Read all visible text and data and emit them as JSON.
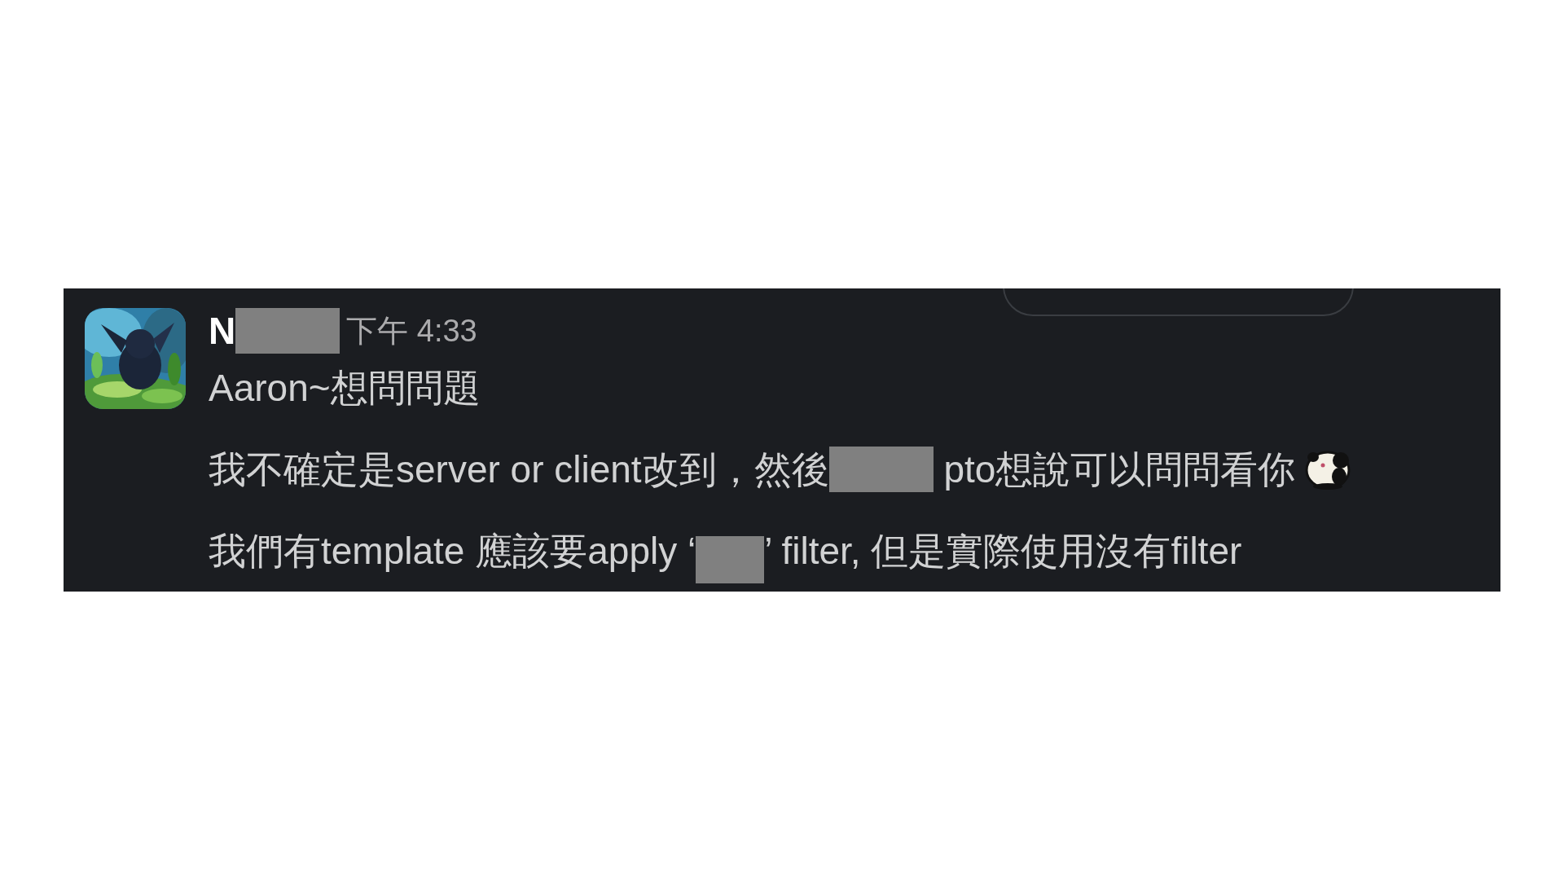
{
  "message": {
    "author": "N",
    "time": "下午 4:33",
    "lines": [
      {
        "segments": [
          {
            "kind": "text",
            "text": "Aaron~想問問題"
          }
        ]
      },
      {
        "segments": [
          {
            "kind": "text",
            "text": "我不確定是server or client改到，然後"
          },
          {
            "kind": "redacted"
          },
          {
            "kind": "text",
            "text": " pto想說可以問問看你"
          },
          {
            "kind": "sticker"
          }
        ]
      },
      {
        "segments": [
          {
            "kind": "text",
            "text": "我們有template 應該要apply ‘"
          },
          {
            "kind": "redacted"
          },
          {
            "kind": "text",
            "text": "’ filter, 但是實際使用沒有filter"
          }
        ]
      }
    ]
  }
}
